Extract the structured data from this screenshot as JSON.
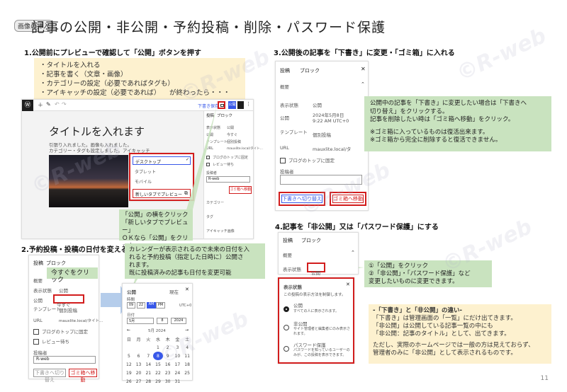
{
  "tag_label": "画像の挿入",
  "page_title": "記事の公開・非公開・予約投稿・削除・パスワード保護",
  "page_number": "11",
  "watermark": "©R-web",
  "sec1": {
    "heading": "1.公開前にプレビューで確認して「公開」ボタンを押す",
    "note": [
      "・タイトルを入れる",
      "・記事を書く（文章・画像）",
      "・カテゴリーの設定（必要であればタグも）",
      "・アイキャッチの設定（必要であれば） 　が終わったら・・・"
    ],
    "editor_title": "タイトルを入れます",
    "editor_text1": "引張り入れました。画像も入れました。",
    "editor_text2": "カテゴリー・タグも設定しました。アイキャッチ",
    "toolbar_preview": "下書き保存",
    "toolbar_publish": "公開",
    "sidebar_tab_post": "投稿",
    "sidebar_tab_block": "ブロック",
    "preview_menu": [
      "デスクトップ",
      "タブレット",
      "モバイル",
      "新しいタブでプレビュー"
    ],
    "callout": [
      "「公開」の横をクリック",
      "「新しいタブでプレビュー」",
      "ＯＫなら「公開」をクリック"
    ],
    "sidebar_labels": [
      "表示状態",
      "公開",
      "テンプレート",
      "URL",
      "ブログのトップに固定",
      "レビュー待ち",
      "投稿者",
      "カテゴリー",
      "タグ",
      "アイキャッチ画像"
    ],
    "sidebar_values": [
      "公開",
      "今すぐ",
      "個別投稿",
      "mauxlite.local/タイト..."
    ],
    "author_value": "R-web",
    "trash_btn": "ゴミ箱へ移動"
  },
  "sec2": {
    "heading": "2.予約投稿・投稿の日付を変える",
    "tab_post": "投稿",
    "tab_block": "ブロック",
    "label_summary": "概要",
    "label_visibility": "表示状態",
    "value_visibility": "公開",
    "label_publish": "公開",
    "value_publish": "今すぐ",
    "label_template": "テンプレート",
    "value_template": "個別投稿",
    "label_url": "URL",
    "value_url": "mauxlite.local/タイト...",
    "sticky": "ブログのトップに固定",
    "pending": "レビュー待ち",
    "author_label": "投稿者",
    "author_value": "R-web",
    "btn_switch": "下書きへ切り替え",
    "btn_trash": "ゴミ箱へ移動",
    "callout_now": "今すぐをクリック",
    "callout_calendar": [
      "カレンダーが表示されるので未来の日付を入",
      "れると予約投稿（指定した日時に）公開さ",
      "れます。",
      "既に投稿済みの記事も日付を変更可能"
    ],
    "cal_publish": "公開",
    "cal_now": "現在",
    "cal_time": "時間",
    "cal_hour": "09",
    "cal_minute": "22",
    "cal_am": "AM",
    "cal_pm": "PM",
    "cal_tz": "UTC+0",
    "cal_date": "日付",
    "cal_month": "5月",
    "cal_day": "8",
    "cal_year": "2024",
    "cal_month_title": "5月 2024",
    "cal_weekdays": [
      "日",
      "月",
      "火",
      "水",
      "木",
      "金",
      "土"
    ],
    "cal_weeks": [
      [
        "",
        "",
        "",
        "1",
        "2",
        "3",
        "4"
      ],
      [
        "5",
        "6",
        "7",
        "8",
        "9",
        "10",
        "11"
      ],
      [
        "12",
        "13",
        "14",
        "15",
        "16",
        "17",
        "18"
      ],
      [
        "19",
        "20",
        "21",
        "22",
        "23",
        "24",
        "25"
      ],
      [
        "26",
        "27",
        "28",
        "29",
        "30",
        "31",
        ""
      ]
    ]
  },
  "sec3": {
    "heading": "3.公開後の記事を「下書き」に変更・「ゴミ箱」に入れる",
    "tab_post": "投稿",
    "tab_block": "ブロック",
    "label_summary": "概要",
    "label_visibility": "表示状態",
    "value_visibility": "公開",
    "label_publish": "公開",
    "value_publish": "2024年5月8日 9:22 AM UTC+0",
    "label_template": "テンプレート",
    "value_template": "個別投稿",
    "label_url": "URL",
    "value_url": "mauxlite.local/タ",
    "sticky": "ブログのトップに固定",
    "author_label": "投稿者",
    "btn_switch": "下書きへ切り替え",
    "btn_trash": "ゴミ箱へ移動",
    "callout": [
      "公開中の記事を「下書き」に変更したい場合は「下書きへ",
      "切り替え」をクリックする。",
      "記事を削除したい時は「ゴミ箱へ移動」をクリック。",
      "",
      "※ゴミ箱に入っているものは復活出来ます。",
      "※ゴミ箱から完全に削除すると復活できません。"
    ]
  },
  "sec4": {
    "heading": "4.記事を「非公開」又は「パスワード保護」にする",
    "tab_post": "投稿",
    "tab_block": "ブロック",
    "label_summary": "概要",
    "label_visibility": "表示状態",
    "value_visibility": "公開",
    "popup_title": "表示状態",
    "popup_desc": "この投稿の表示方法を制御します。",
    "options": [
      {
        "label": "公開",
        "desc": "すべての人に表示されます。"
      },
      {
        "label": "非公開",
        "desc": "サイト管理者と編集者にのみ表示されます。"
      },
      {
        "label": "パスワード保護",
        "desc": "パスワードを知っているユーザーのみが、この投稿を表示できます。"
      }
    ],
    "callout": [
      "①「公開」をクリック",
      "②「非公開」・「パスワード保護」など",
      "変更したいものに変更できます。"
    ],
    "explain": [
      "-「下書き」と「非公開」の違い-",
      "「下書き」は管理画面の「一覧」にだけ出てきます。",
      "「非公開」は公開している記事一覧の中にも",
      "「非公開：記事のタイトル」として、出てきます。",
      "",
      "ただし、実際のホームページでは一般の方は見えておらず、",
      "管理者のみに「非公開」として表示されるものです。"
    ]
  }
}
